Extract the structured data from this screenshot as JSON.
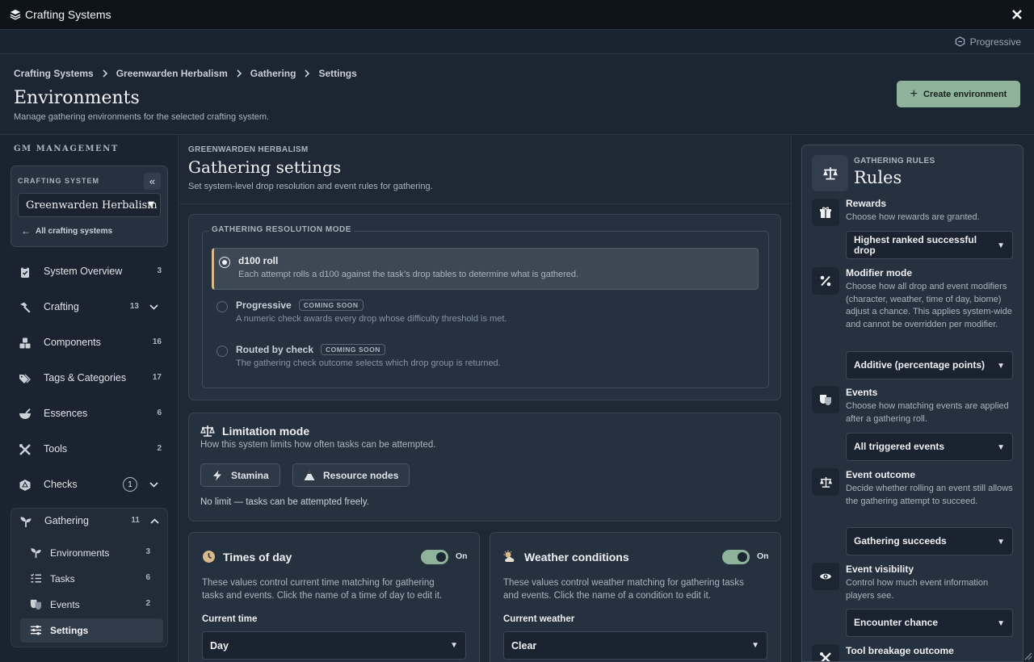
{
  "window": {
    "title": "Crafting Systems",
    "mode_label": "Progressive"
  },
  "breadcrumb": [
    "Crafting Systems",
    "Greenwarden Herbalism",
    "Gathering",
    "Settings"
  ],
  "header": {
    "title": "Environments",
    "subtitle": "Manage gathering environments for the selected crafting system.",
    "create_label": "Create environment"
  },
  "sidebar": {
    "heading": "GM MANAGEMENT",
    "crafting_system_label": "CRAFTING SYSTEM",
    "collapse_glyph": "«",
    "selected_system": "Greenwarden Herbalism",
    "back_label": "All crafting systems",
    "items": [
      {
        "label": "System Overview",
        "count": "3"
      },
      {
        "label": "Crafting",
        "count": "13"
      },
      {
        "label": "Components",
        "count": "16"
      },
      {
        "label": "Tags & Categories",
        "count": "17"
      },
      {
        "label": "Essences",
        "count": "6"
      },
      {
        "label": "Tools",
        "count": "2"
      },
      {
        "label": "Checks",
        "count": "1"
      },
      {
        "label": "Gathering",
        "count": "11"
      }
    ],
    "gathering_sub": [
      {
        "label": "Environments",
        "count": "3"
      },
      {
        "label": "Tasks",
        "count": "6"
      },
      {
        "label": "Events",
        "count": "2"
      },
      {
        "label": "Settings",
        "count": ""
      }
    ]
  },
  "main": {
    "eyebrow": "GREENWARDEN HERBALISM",
    "title": "Gathering settings",
    "subtitle": "Set system-level drop resolution and event rules for gathering.",
    "resolution": {
      "legend": "GATHERING RESOLUTION MODE",
      "options": [
        {
          "title": "d100 roll",
          "desc": "Each attempt rolls a d100 against the task’s drop tables to determine what is gathered.",
          "pill": ""
        },
        {
          "title": "Progressive",
          "desc": "A numeric check awards every drop whose difficulty threshold is met.",
          "pill": "COMING SOON"
        },
        {
          "title": "Routed by check",
          "desc": "The gathering check outcome selects which drop group is returned.",
          "pill": "COMING SOON"
        }
      ]
    },
    "limitation": {
      "title": "Limitation mode",
      "subtitle": "How this system limits how often tasks can be attempted.",
      "chips": [
        "Stamina",
        "Resource nodes"
      ],
      "note": "No limit — tasks can be attempted freely."
    },
    "times_of_day": {
      "title": "Times of day",
      "toggle_label": "On",
      "desc": "These values control current time matching for gathering tasks and events. Click the name of a time of day to edit it.",
      "field_label": "Current time",
      "value": "Day"
    },
    "weather": {
      "title": "Weather conditions",
      "toggle_label": "On",
      "desc": "These values control weather matching for gathering tasks and events. Click the name of a condition to edit it.",
      "field_label": "Current weather",
      "value": "Clear"
    }
  },
  "rules": {
    "eyebrow": "GATHERING RULES",
    "title": "Rules",
    "items": [
      {
        "title": "Rewards",
        "desc": "Choose how rewards are granted.",
        "value": "Highest ranked successful drop"
      },
      {
        "title": "Modifier mode",
        "desc": "Choose how all drop and event modifiers (character, weather, time of day, biome) adjust a chance. This applies system-wide and cannot be overridden per modifier.",
        "value": "Additive (percentage points)"
      },
      {
        "title": "Events",
        "desc": "Choose how matching events are applied after a gathering roll.",
        "value": "All triggered events"
      },
      {
        "title": "Event outcome",
        "desc": "Decide whether rolling an event still allows the gathering attempt to succeed.",
        "value": "Gathering succeeds"
      },
      {
        "title": "Event visibility",
        "desc": "Control how much event information players see.",
        "value": "Encounter chance"
      },
      {
        "title": "Tool breakage outcome",
        "desc": "",
        "value": ""
      }
    ]
  },
  "colors": {
    "accent": "#8fb29a",
    "selected_bar": "#d9b98a",
    "background": "#1c2633"
  }
}
